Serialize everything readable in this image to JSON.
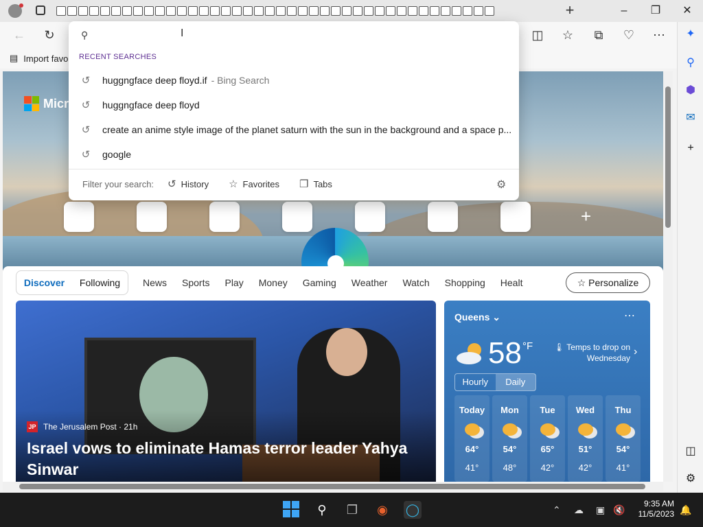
{
  "toolbar": {
    "bookmark_import": "Import favo"
  },
  "search_dropdown": {
    "section_title": "RECENT SEARCHES",
    "suggestions": [
      {
        "text": "huggngface deep floyd.if",
        "hint": "- Bing Search"
      },
      {
        "text": "huggngface deep floyd",
        "hint": ""
      },
      {
        "text": "create an anime style image of the planet saturn with the sun in the background and a space p...",
        "hint": ""
      },
      {
        "text": "google",
        "hint": ""
      }
    ],
    "filter_label": "Filter your search:",
    "filters": [
      "History",
      "Favorites",
      "Tabs"
    ]
  },
  "hero": {
    "brand": "Micro"
  },
  "feed_nav": {
    "pill": [
      "Discover",
      "Following"
    ],
    "tabs": [
      "News",
      "Sports",
      "Play",
      "Money",
      "Gaming",
      "Weather",
      "Watch",
      "Shopping",
      "Healt"
    ],
    "personalize": "Personalize"
  },
  "news": {
    "source": "The Jerusalem Post · 21h",
    "source_logo": "JP",
    "headline": "Israel vows to eliminate Hamas terror leader Yahya Sinwar"
  },
  "weather": {
    "location": "Queens",
    "temperature": "58",
    "unit": "°F",
    "alert": "Temps to drop on Wednesday",
    "toggle": [
      "Hourly",
      "Daily"
    ],
    "days": [
      {
        "name": "Today",
        "high": "64°",
        "low": "41°"
      },
      {
        "name": "Mon",
        "high": "54°",
        "low": "48°"
      },
      {
        "name": "Tue",
        "high": "65°",
        "low": "42°"
      },
      {
        "name": "Wed",
        "high": "51°",
        "low": "42°"
      },
      {
        "name": "Thu",
        "high": "54°",
        "low": "41°"
      }
    ]
  },
  "taskbar": {
    "time": "9:35 AM",
    "date": "11/5/2023"
  },
  "colors": {
    "accent": "#0f6cbd",
    "section_title": "#5c2d91",
    "weather_bg": "#3b7fc4",
    "taskbar_bg": "#1c1c1c"
  }
}
